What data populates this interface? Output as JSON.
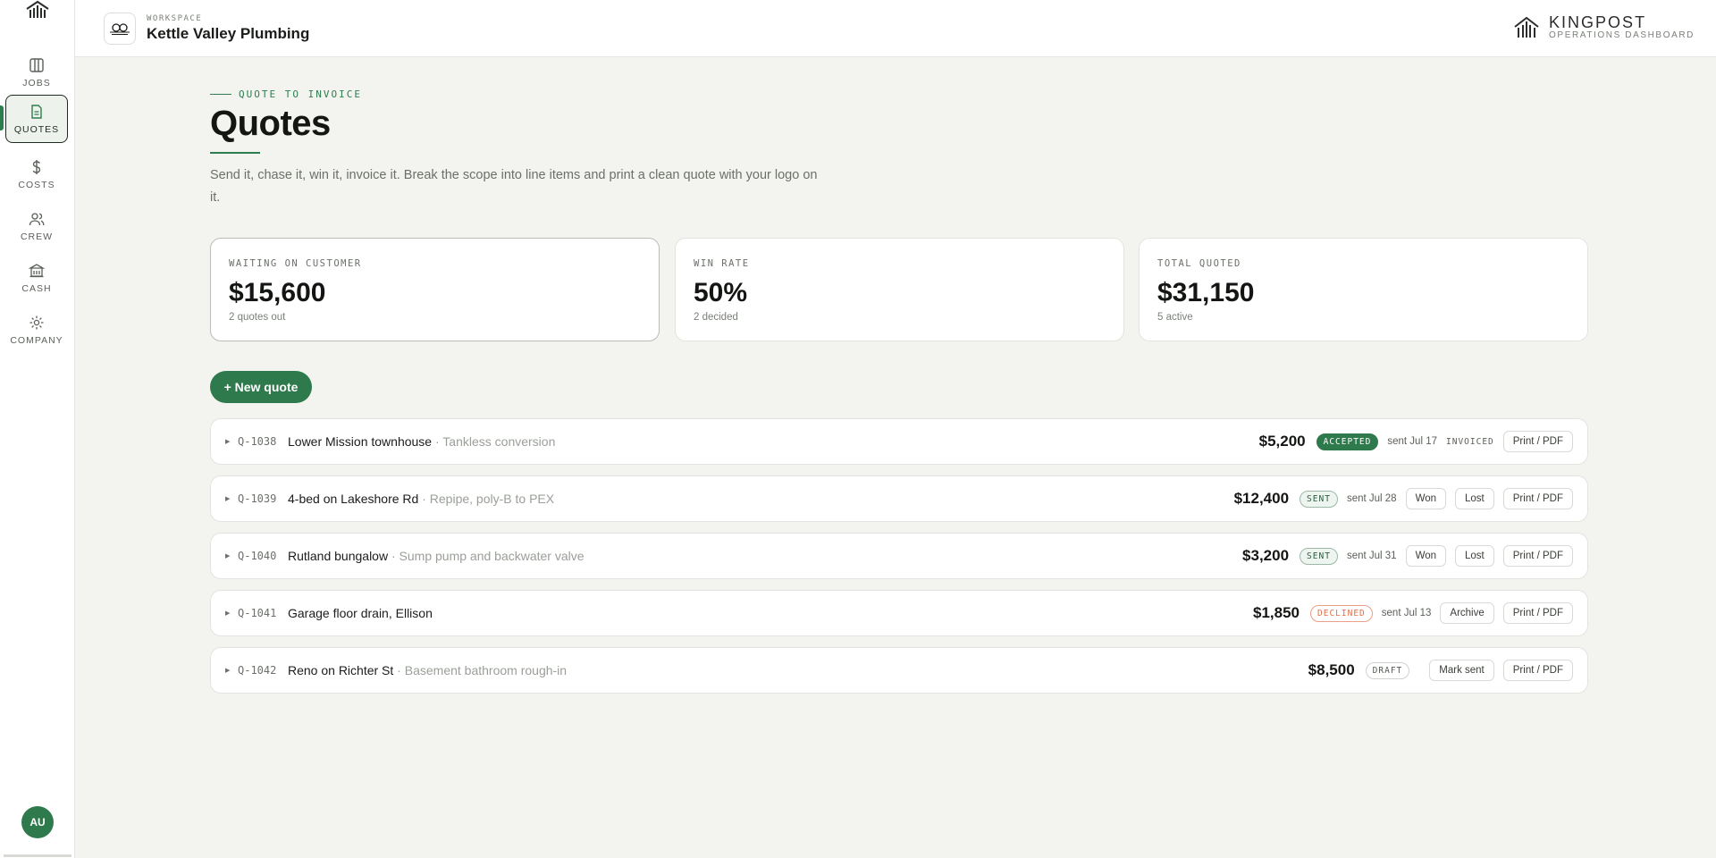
{
  "sidebar": {
    "items": [
      {
        "label": "JOBS",
        "icon": "columns-icon"
      },
      {
        "label": "QUOTES",
        "icon": "document-icon"
      },
      {
        "label": "COSTS",
        "icon": "dollar-icon"
      },
      {
        "label": "CREW",
        "icon": "people-icon"
      },
      {
        "label": "CASH",
        "icon": "bank-icon"
      },
      {
        "label": "COMPANY",
        "icon": "gear-icon"
      }
    ],
    "avatar": "AU"
  },
  "header": {
    "kicker": "WORKSPACE",
    "workspace": "Kettle Valley Plumbing",
    "brand_title": "KINGPOST",
    "brand_subtitle": "OPERATIONS DASHBOARD"
  },
  "page": {
    "kicker": "QUOTE TO INVOICE",
    "title": "Quotes",
    "description": "Send it, chase it, win it, invoice it. Break the scope into line items and print a clean quote with your logo on it."
  },
  "stats": [
    {
      "label": "WAITING ON CUSTOMER",
      "value": "$15,600",
      "sub": "2 quotes out"
    },
    {
      "label": "WIN RATE",
      "value": "50%",
      "sub": "2 decided"
    },
    {
      "label": "TOTAL QUOTED",
      "value": "$31,150",
      "sub": "5 active"
    }
  ],
  "new_quote_label": "+ New quote",
  "quotes": [
    {
      "id": "Q-1038",
      "title": "Lower Mission townhouse",
      "subtitle": "Tankless conversion",
      "amount": "$5,200",
      "status": "ACCEPTED",
      "sent": "sent Jul 17",
      "invoiced": "INVOICED",
      "print": "Print / PDF"
    },
    {
      "id": "Q-1039",
      "title": "4-bed on Lakeshore Rd",
      "subtitle": "Repipe, poly-B to PEX",
      "amount": "$12,400",
      "status": "SENT",
      "sent": "sent Jul 28",
      "won": "Won",
      "lost": "Lost",
      "print": "Print / PDF"
    },
    {
      "id": "Q-1040",
      "title": "Rutland bungalow",
      "subtitle": "Sump pump and backwater valve",
      "amount": "$3,200",
      "status": "SENT",
      "sent": "sent Jul 31",
      "won": "Won",
      "lost": "Lost",
      "print": "Print / PDF"
    },
    {
      "id": "Q-1041",
      "title": "Garage floor drain, Ellison",
      "subtitle": "",
      "amount": "$1,850",
      "status": "DECLINED",
      "sent": "sent Jul 13",
      "archive": "Archive",
      "print": "Print / PDF"
    },
    {
      "id": "Q-1042",
      "title": "Reno on Richter St",
      "subtitle": "Basement bathroom rough-in",
      "amount": "$8,500",
      "status": "DRAFT",
      "mark_sent": "Mark sent",
      "print": "Print / PDF"
    }
  ],
  "colors": {
    "accent": "#2e7a4c",
    "declined": "#e0704a",
    "background": "#f3f4f0"
  }
}
